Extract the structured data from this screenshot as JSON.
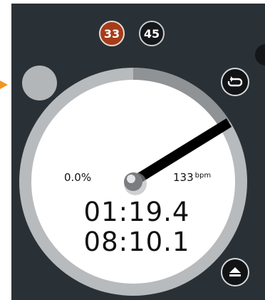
{
  "deck": {
    "speed_buttons": [
      {
        "label": "33",
        "active": true,
        "color": "#a63c1a"
      },
      {
        "label": "45",
        "active": false,
        "color": "#151718"
      }
    ],
    "pitch": "0.0%",
    "bpm": {
      "value": "133",
      "unit": "bpm"
    },
    "elapsed_time": "01:19.4",
    "total_time": "08:10.1",
    "progress_fraction": 0.162,
    "icons": {
      "loop": "loop-icon",
      "eject": "eject-icon",
      "side_indicator": "arrow-right-icon"
    },
    "colors": {
      "panel": "#2a3136",
      "ring_track": "#b8bbbd",
      "ring_progress": "#8f9396",
      "platter": "#ffffff",
      "accent": "#f39422",
      "active_speed": "#a63c1a"
    }
  }
}
